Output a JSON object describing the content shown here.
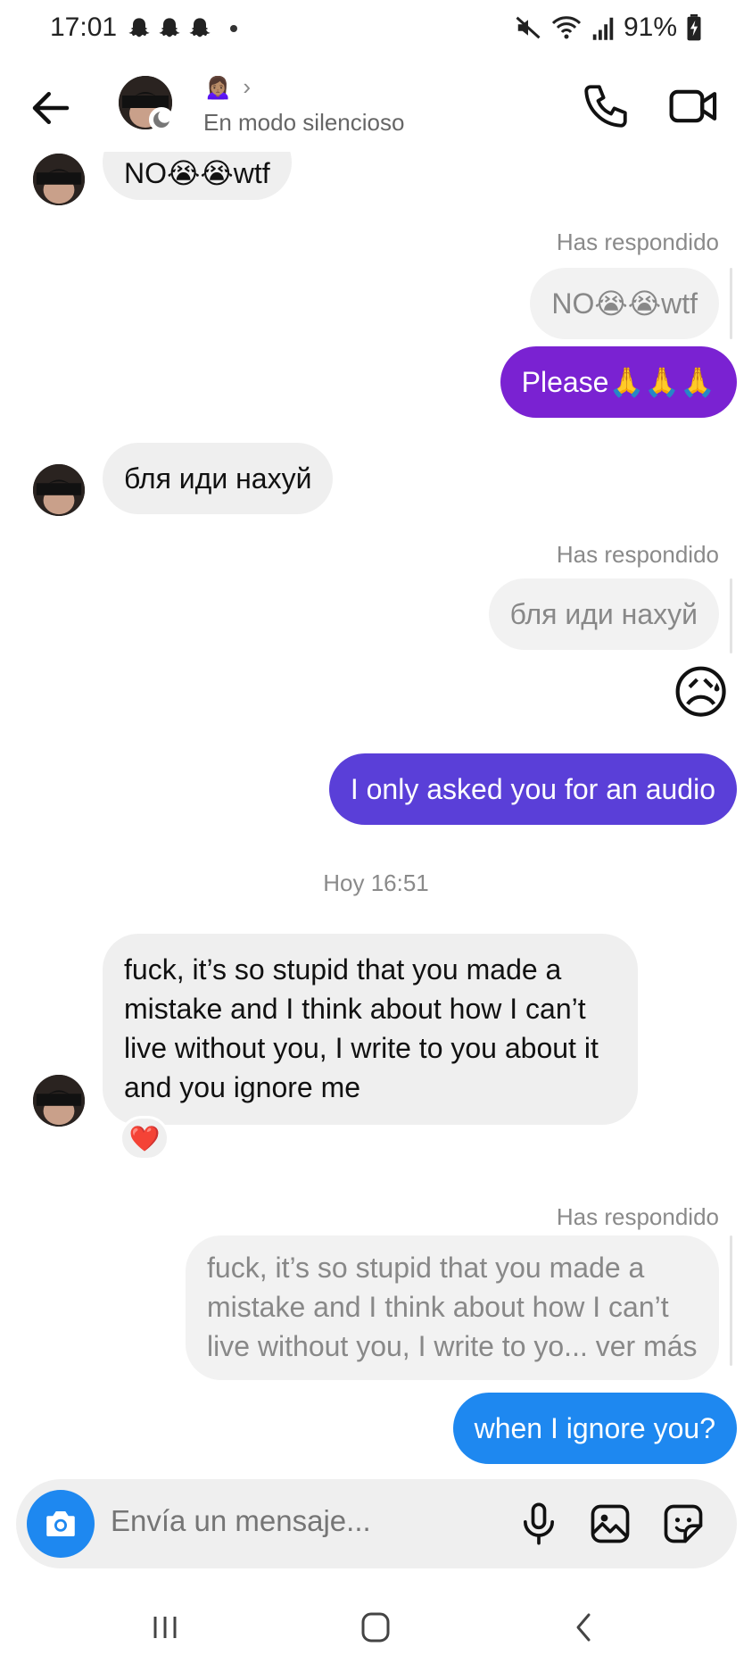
{
  "status_bar": {
    "time": "17:01",
    "battery": "91%"
  },
  "header": {
    "contact_emoji": "🙍🏽‍♀️",
    "contact_status": "En modo silencioso"
  },
  "messages": {
    "m1_text_prefix": "NO",
    "m1_emojis": "😭😭",
    "m1_text_suffix": "wtf",
    "reply_label": "Has respondido",
    "r1_text_prefix": "NO",
    "r1_emojis": "😭😭",
    "r1_text_suffix": "wtf",
    "m2_text": "Please",
    "m2_emojis": "🙏🙏🙏",
    "m3_text": "бля иди нахуй",
    "r2_text": "бля иди нахуй",
    "big_emoji": "😥",
    "m4_text": "I only asked you for an audio",
    "timestamp": "Hoy 16:51",
    "m5_text": "fuck, it’s so stupid that you made a mistake and I think about how I can’t live without you, I write to you about it and you ignore me",
    "m5_reaction": "❤️",
    "r3_text": "fuck, it’s so stupid that you made a mistake and I think about how I can’t live without you, I write to yo... ver más",
    "m6_text": "when I ignore you?"
  },
  "composer": {
    "placeholder": "Envía un mensaje..."
  },
  "colors": {
    "purple_bubble": "#7a22d2",
    "violet_bubble": "#5a3fd8",
    "blue_bubble": "#1e88f0",
    "incoming_bubble": "#efefef"
  },
  "icons": {
    "back": "arrow-left-icon",
    "call": "phone-icon",
    "video": "video-camera-icon",
    "camera": "camera-icon",
    "mic": "microphone-icon",
    "gallery": "image-icon",
    "sticker": "sticker-icon",
    "notifications": "snapchat-ghost-icon"
  }
}
